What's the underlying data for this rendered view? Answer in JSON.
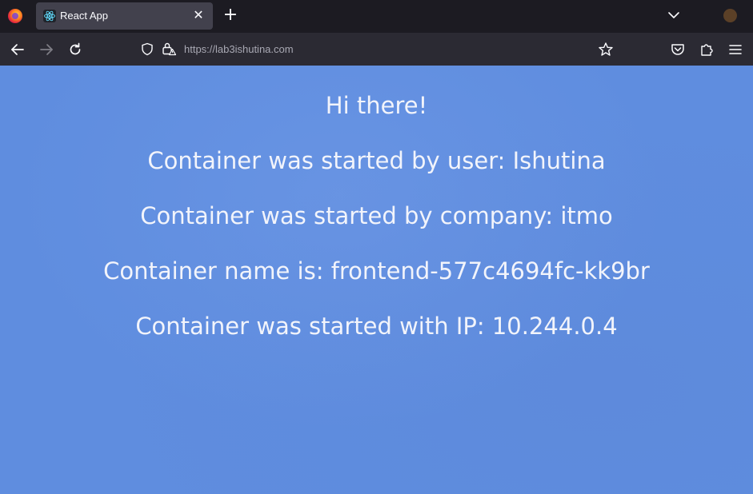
{
  "browser": {
    "tab": {
      "title": "React App",
      "close_label": "✕"
    },
    "new_tab_label": "+",
    "url": "https://lab3ishutina.com",
    "accent_color": "#1c1b22"
  },
  "page": {
    "background_color": "#5f8ddf",
    "lines": [
      "Hi there!",
      "Container was started by user: Ishutina",
      "Container was started by company: itmo",
      "Container name is: frontend-577c4694fc-kk9br",
      "Container was started with IP: 10.244.0.4"
    ]
  }
}
